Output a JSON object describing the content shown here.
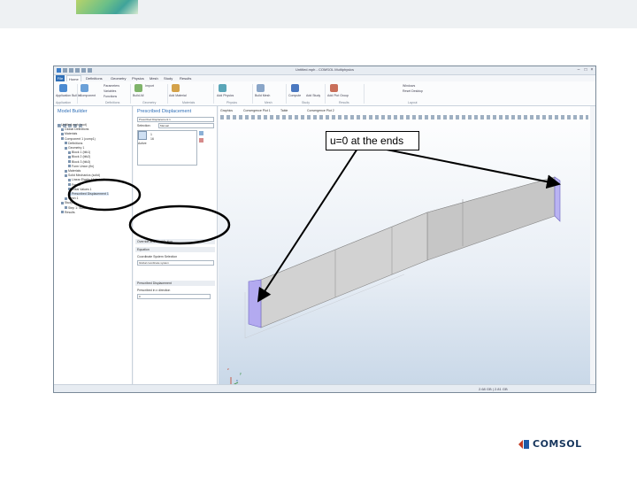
{
  "callout": {
    "text": "u=0 at the ends"
  },
  "brand": {
    "logo_text": "COMSOL",
    "accent": "#1f5aa6",
    "mark_color": "#c23b22"
  },
  "window": {
    "title": "Untitled.mph - COMSOL Multiphysics"
  },
  "menu": {
    "tabs": [
      "File",
      "Home",
      "Definitions",
      "Geometry",
      "Physics",
      "Mesh",
      "Study",
      "Results"
    ]
  },
  "ribbon": {
    "buttons": [
      "Application Builder",
      "Component",
      "Add Component",
      "Parameters",
      "Variables",
      "Functions",
      "Build All",
      "Import",
      "Add Material",
      "Physics",
      "Add Physics",
      "Build Mesh",
      "Mesh",
      "Compute",
      "Study",
      "Add Study",
      "Add Plot Group",
      "Windows",
      "Reset Desktop"
    ],
    "groups": [
      "Application",
      "Model",
      "Definitions",
      "Geometry",
      "Materials",
      "Physics",
      "Mesh",
      "Study",
      "Results",
      "Layout"
    ]
  },
  "model_builder": {
    "title": "Model Builder",
    "tree": [
      "Untitled.mph (root)",
      "Global Definitions",
      "Materials",
      "Component 1 (comp1)",
      "Definitions",
      "Geometry 1",
      "Block 1 (blk1)",
      "Block 2 (blk2)",
      "Block 3 (blk3)",
      "Form Union (fin)",
      "Materials",
      "Solid Mechanics (solid)",
      "Linear Elastic Material 1",
      "Free 1",
      "Initial Values 1",
      "Prescribed Displacement 1",
      "Mesh 1",
      "Study 1",
      "Step 1: Stationary",
      "Results"
    ],
    "selected_index": 15
  },
  "settings": {
    "title": "Prescribed Displacement",
    "label": "Prescribed Displacement 1",
    "selection_label": "Selection:",
    "selection_value": "Manual",
    "list": [
      "1",
      "16"
    ],
    "active_label": "Active",
    "sections": [
      "Override and Contribution",
      "Equation",
      "Coordinate System Selection",
      "Prescribed Displacement"
    ],
    "coord_value": "Global coordinate system",
    "displacement_label": "Prescribed in x direction",
    "displacement_value": "0"
  },
  "graphics": {
    "tabs": [
      "Graphics",
      "Convergence Plot 1",
      "Table",
      "Convergence Plot 2"
    ],
    "axis_labels": [
      "z",
      "y",
      "x"
    ]
  },
  "status": {
    "memory": "2.68 GB | 2.81 GB"
  }
}
